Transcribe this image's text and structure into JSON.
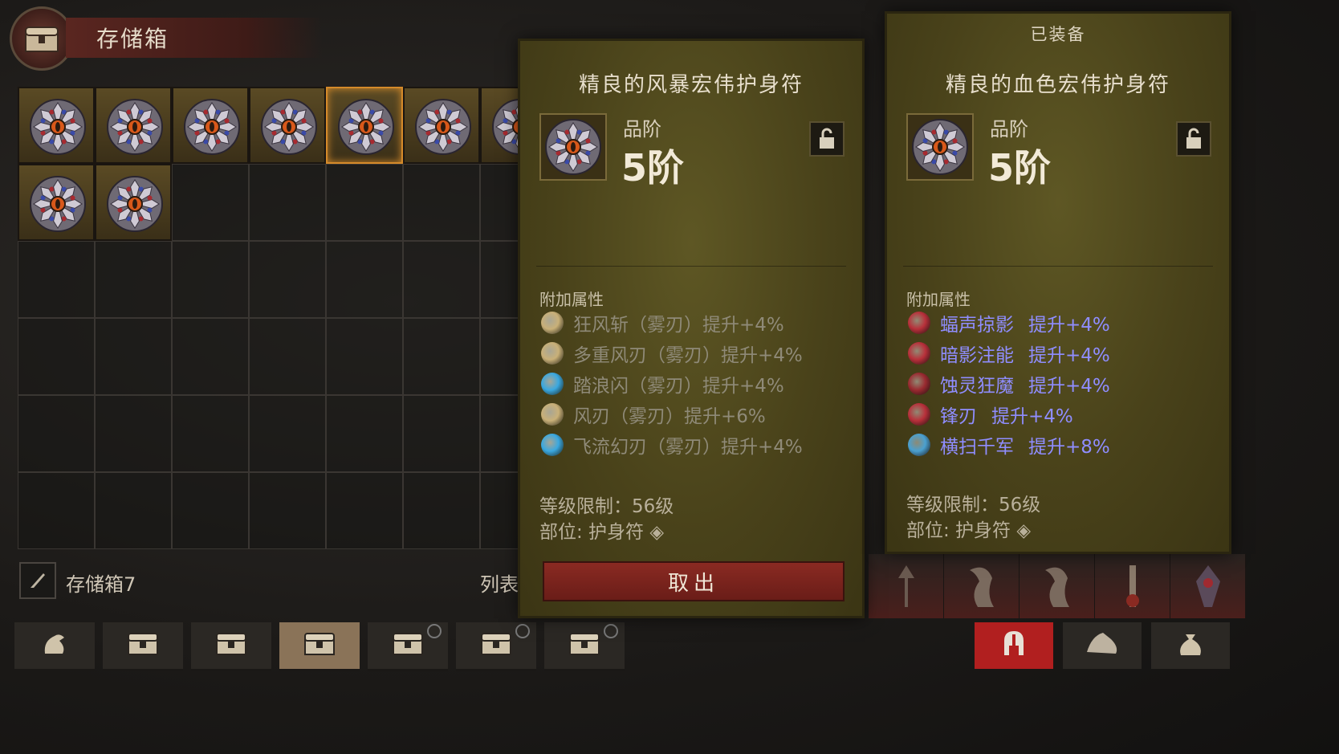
{
  "stash": {
    "title": "存储箱",
    "name": "存储箱7",
    "list_label": "列表",
    "filled_slots": [
      0,
      1,
      2,
      3,
      4,
      5,
      6,
      7,
      8
    ],
    "selected_slot": 4,
    "icons": {
      "emblem": "chest-icon",
      "item": "amulet-icon",
      "rename": "quill-icon"
    }
  },
  "tabs": [
    {
      "icon": "bag-icon",
      "locked": false,
      "active": false
    },
    {
      "icon": "chest-icon",
      "locked": false,
      "active": false
    },
    {
      "icon": "chest-icon",
      "locked": false,
      "active": false
    },
    {
      "icon": "chest-icon",
      "locked": false,
      "active": true
    },
    {
      "icon": "chest-icon",
      "locked": true,
      "active": false
    },
    {
      "icon": "chest-icon",
      "locked": true,
      "active": false
    },
    {
      "icon": "chest-icon",
      "locked": true,
      "active": false
    }
  ],
  "right_tabs": [
    {
      "icon": "helmet-icon",
      "active": true
    },
    {
      "icon": "gem-icon",
      "active": false
    },
    {
      "icon": "pouch-icon",
      "active": false
    }
  ],
  "hovered_item": {
    "name": "精良的风暴宏伟护身符",
    "tier_label": "品阶",
    "tier_value": "5阶",
    "attr_heading": "附加属性",
    "attributes": [
      {
        "text": "狂风斩（雾刃）提升+4%",
        "icon_color": "#c9b078"
      },
      {
        "text": "多重风刃（雾刃）提升+4%",
        "icon_color": "#c9b078"
      },
      {
        "text": "踏浪闪（雾刃）提升+4%",
        "icon_color": "#3aa8e0"
      },
      {
        "text": "风刃（雾刃）提升+6%",
        "icon_color": "#c9b078"
      },
      {
        "text": "飞流幻刃（雾刃）提升+4%",
        "icon_color": "#3aa8e0"
      }
    ],
    "level_req": "等级限制：56级",
    "slot": "部位: 护身符",
    "take_button": "取出"
  },
  "equipped_item": {
    "header": "已装备",
    "name": "精良的血色宏伟护身符",
    "tier_label": "品阶",
    "tier_value": "5阶",
    "attr_heading": "附加属性",
    "attributes": [
      {
        "name": "蝠声掠影",
        "value": "提升+4%",
        "icon_color": "#b8303a"
      },
      {
        "name": "暗影注能",
        "value": "提升+4%",
        "icon_color": "#b8303a"
      },
      {
        "name": "蚀灵狂魔",
        "value": "提升+4%",
        "icon_color": "#9a2a30"
      },
      {
        "name": "锋刃",
        "value": "提升+4%",
        "icon_color": "#b8303a"
      },
      {
        "name": "横扫千军",
        "value": "提升+8%",
        "icon_color": "#4aa0d0"
      }
    ],
    "level_req": "等级限制：56级",
    "slot": "部位: 护身符"
  },
  "colors": {
    "selected_border": "#d58a2a",
    "buff_text": "#8f8dff",
    "take_button": "#8a2a22",
    "active_right_tab": "#b11f1f"
  }
}
